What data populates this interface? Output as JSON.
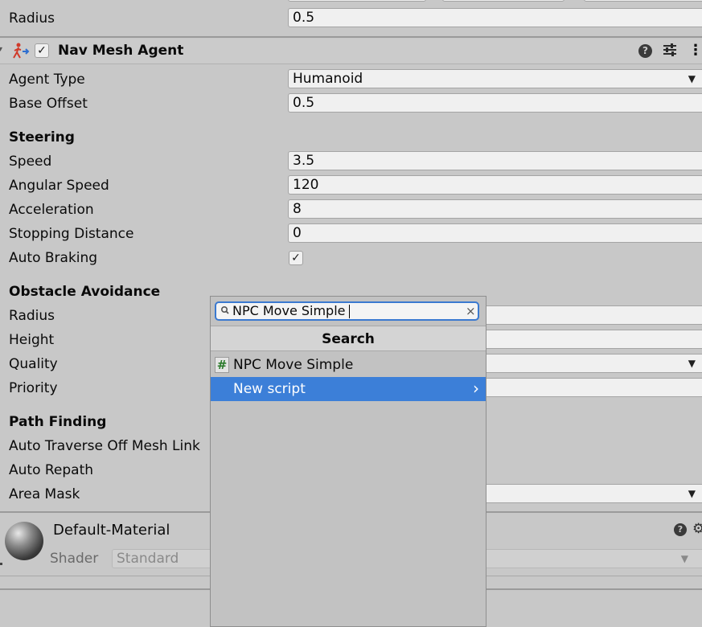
{
  "top": {
    "radius_label": "Radius",
    "radius_value": "0.5"
  },
  "nav_mesh_agent": {
    "title": "Nav Mesh Agent",
    "enabled_check": "✓",
    "agent_type_label": "Agent Type",
    "agent_type_value": "Humanoid",
    "base_offset_label": "Base Offset",
    "base_offset_value": "0.5",
    "steering_header": "Steering",
    "speed_label": "Speed",
    "speed_value": "3.5",
    "angular_speed_label": "Angular Speed",
    "angular_speed_value": "120",
    "acceleration_label": "Acceleration",
    "acceleration_value": "8",
    "stopping_distance_label": "Stopping Distance",
    "stopping_distance_value": "0",
    "auto_braking_label": "Auto Braking",
    "auto_braking_check": "✓",
    "obstacle_header": "Obstacle Avoidance",
    "radius_label": "Radius",
    "height_label": "Height",
    "quality_label": "Quality",
    "priority_label": "Priority",
    "path_header": "Path Finding",
    "auto_traverse_label": "Auto Traverse Off Mesh Link",
    "auto_repath_label": "Auto Repath",
    "area_mask_label": "Area Mask",
    "help_icon": "?",
    "presets_icon": "⇄",
    "menu_icon": "⋮"
  },
  "material": {
    "name": "Default-Material",
    "shader_label": "Shader",
    "shader_value": "Standard"
  },
  "add_component_popup": {
    "search_value": "NPC Move Simple",
    "header": "Search",
    "items": [
      {
        "icon": "#",
        "label": "NPC Move Simple"
      },
      {
        "label": "New script",
        "arrow": "›"
      }
    ]
  },
  "colors": {
    "accent": "#3c7fd8",
    "background": "#c8c8c8"
  }
}
